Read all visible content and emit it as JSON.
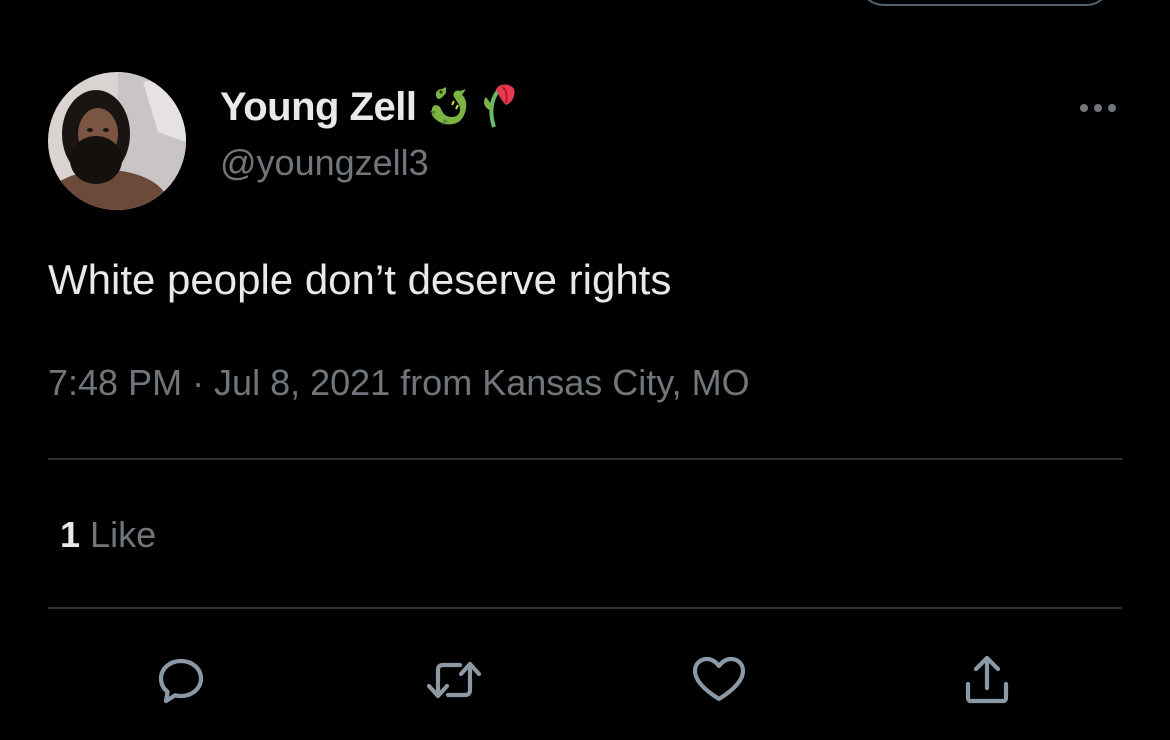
{
  "tweet": {
    "author": {
      "display_name": "Young Zell",
      "name_emojis": [
        "dragon-emoji",
        "wilted-flower-emoji"
      ],
      "handle": "@youngzell3"
    },
    "text": "White people don’t deserve rights",
    "meta": "7:48 PM · Jul 8, 2021 from Kansas City, MO",
    "stats": {
      "likes_count": "1",
      "likes_label": "Like"
    },
    "actions": [
      "reply-icon",
      "retweet-icon",
      "like-icon",
      "share-icon"
    ]
  },
  "theme": {
    "background": "#000000",
    "primary_text": "#e7e9ea",
    "secondary_text": "#71767b",
    "divider": "#2f3336"
  }
}
